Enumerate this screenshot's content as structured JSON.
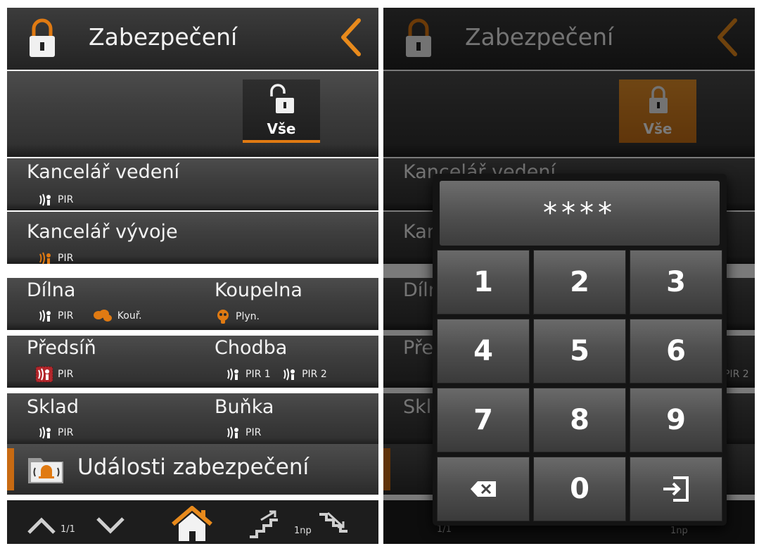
{
  "header": {
    "title": "Zabezpečení"
  },
  "all_button": {
    "label": "Vše"
  },
  "zones": [
    {
      "name": "Kancelář vedení",
      "sensors": [
        {
          "label": "PIR"
        }
      ]
    },
    {
      "name": "Kancelář vývoje",
      "sensors": [
        {
          "label": "PIR"
        }
      ]
    },
    {
      "name": "Dílna",
      "sensors": [
        {
          "label": "PIR"
        },
        {
          "label": "Kouř."
        }
      ]
    },
    {
      "name": "Koupelna",
      "sensors": [
        {
          "label": "Plyn."
        }
      ]
    },
    {
      "name": "Předsíň",
      "sensors": [
        {
          "label": "PIR"
        }
      ]
    },
    {
      "name": "Chodba",
      "sensors": [
        {
          "label": "PIR 1"
        },
        {
          "label": "PIR 2"
        }
      ]
    },
    {
      "name": "Sklad",
      "sensors": [
        {
          "label": "PIR"
        }
      ]
    },
    {
      "name": "Buňka",
      "sensors": [
        {
          "label": "PIR"
        }
      ]
    }
  ],
  "events": {
    "label": "Události zabezpečení"
  },
  "footer": {
    "page": "1/1",
    "floor": "1np"
  },
  "keypad": {
    "pin_display": "****",
    "keys": [
      "1",
      "2",
      "3",
      "4",
      "5",
      "6",
      "7",
      "8",
      "9",
      "0"
    ]
  },
  "colors": {
    "accent": "#e07a12",
    "alarm": "#b3262b",
    "background": "#2f2f2f"
  },
  "icons": [
    "lock-icon",
    "unlock-icon",
    "back-chevron-icon",
    "pir-sensor-icon",
    "smoke-sensor-icon",
    "gas-sensor-icon",
    "bell-folder-icon",
    "up-arrow-icon",
    "down-arrow-icon",
    "home-icon",
    "stairs-up-icon",
    "stairs-down-icon",
    "backspace-icon",
    "enter-icon"
  ]
}
